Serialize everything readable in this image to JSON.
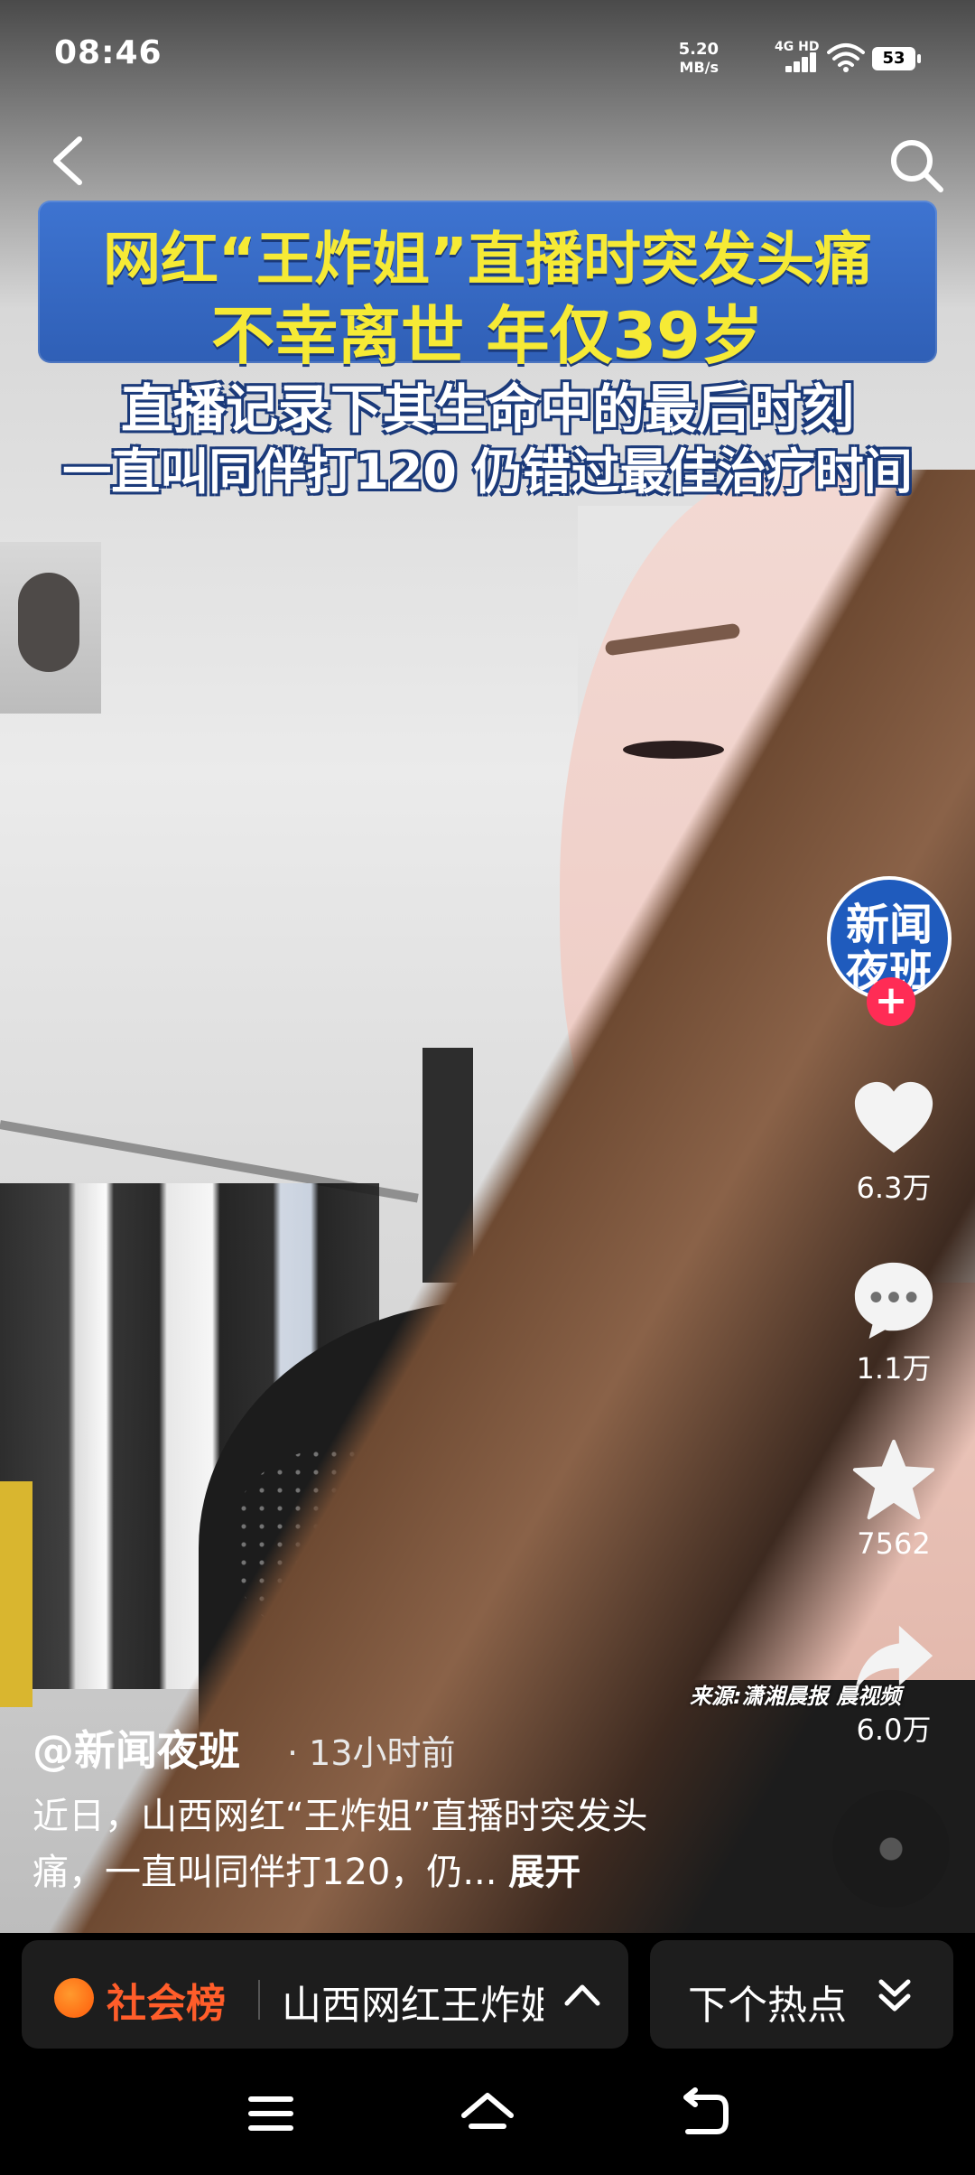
{
  "status_bar": {
    "time": "08:46",
    "net_speed": "5.20",
    "net_unit": "MB/s",
    "network_type": "4G HD",
    "battery": "53"
  },
  "header": {
    "back_icon": "chevron-left-icon",
    "search_icon": "search-icon"
  },
  "video_title": {
    "line1": "网红“王炸姐”直播时突发头痛",
    "line2": "不幸离世  年仅39岁",
    "sub1": "直播记录下其生命中的最后时刻",
    "sub2": "一直叫同伴打120  仍错过最佳治疗时间"
  },
  "rail": {
    "avatar_line1": "新闻",
    "avatar_line2": "夜班",
    "follow_symbol": "+",
    "like_count": "6.3万",
    "comment_count": "1.1万",
    "favorite_count": "7562",
    "share_count": "6.0万",
    "source": "来源:潇湘晨报 晨视频"
  },
  "caption": {
    "author": "@新闻夜班",
    "time_ago": "· 13小时前",
    "description": "近日，山西网红“王炸姐”直播时突发头痛，一直叫同伴打120，仍...",
    "expand": "展开"
  },
  "bottom_bar": {
    "hot_list_name": "社会榜",
    "hot_topic": "山西网红王炸姐",
    "next_label": "下个热点"
  },
  "colors": {
    "banner_blue": "#3e74d1",
    "title_yellow": "#f6ea35",
    "accent_red": "#ff2c55",
    "hot_orange": "#ff5d2a"
  }
}
